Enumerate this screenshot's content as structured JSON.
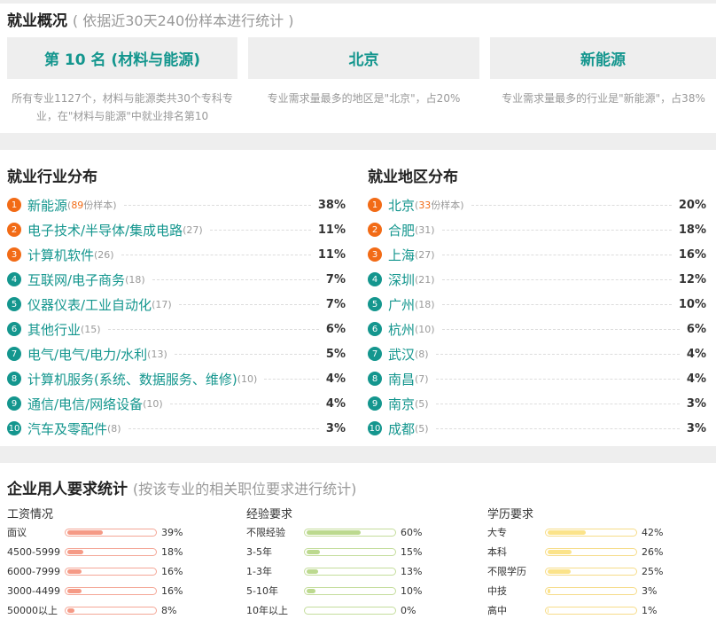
{
  "overview": {
    "title": "就业概况",
    "subtitle": "( 依据近30天240份样本进行统计 )",
    "cards": [
      {
        "main": "第 10 名 (材料与能源)",
        "desc": "所有专业1127个，材料与能源类共30个专科专业，在\"材料与能源\"中就业排名第10"
      },
      {
        "main": "北京",
        "desc": "专业需求量最多的地区是\"北京\"，占20%"
      },
      {
        "main": "新能源",
        "desc": "专业需求量最多的行业是\"新能源\"，占38%"
      }
    ]
  },
  "industry": {
    "title": "就业行业分布",
    "items": [
      {
        "rank": "1",
        "name": "新能源",
        "count_prefix": "(",
        "count_num": "89",
        "count_suffix": "份样本)",
        "pct": "38%"
      },
      {
        "rank": "2",
        "name": "电子技术/半导体/集成电路",
        "count_prefix": "(27)",
        "count_num": "",
        "count_suffix": "",
        "pct": "11%"
      },
      {
        "rank": "3",
        "name": "计算机软件",
        "count_prefix": "(26)",
        "count_num": "",
        "count_suffix": "",
        "pct": "11%"
      },
      {
        "rank": "4",
        "name": "互联网/电子商务",
        "count_prefix": "(18)",
        "count_num": "",
        "count_suffix": "",
        "pct": "7%"
      },
      {
        "rank": "5",
        "name": "仪器仪表/工业自动化",
        "count_prefix": "(17)",
        "count_num": "",
        "count_suffix": "",
        "pct": "7%"
      },
      {
        "rank": "6",
        "name": "其他行业",
        "count_prefix": "(15)",
        "count_num": "",
        "count_suffix": "",
        "pct": "6%"
      },
      {
        "rank": "7",
        "name": "电气/电气/电力/水利",
        "count_prefix": "(13)",
        "count_num": "",
        "count_suffix": "",
        "pct": "5%"
      },
      {
        "rank": "8",
        "name": "计算机服务(系统、数据服务、维修)",
        "count_prefix": "(10)",
        "count_num": "",
        "count_suffix": "",
        "pct": "4%"
      },
      {
        "rank": "9",
        "name": "通信/电信/网络设备",
        "count_prefix": "(10)",
        "count_num": "",
        "count_suffix": "",
        "pct": "4%"
      },
      {
        "rank": "10",
        "name": "汽车及零配件",
        "count_prefix": "(8)",
        "count_num": "",
        "count_suffix": "",
        "pct": "3%"
      }
    ]
  },
  "region": {
    "title": "就业地区分布",
    "items": [
      {
        "rank": "1",
        "name": "北京",
        "count_prefix": "(",
        "count_num": "33",
        "count_suffix": "份样本)",
        "pct": "20%"
      },
      {
        "rank": "2",
        "name": "合肥",
        "count_prefix": "(31)",
        "count_num": "",
        "count_suffix": "",
        "pct": "18%"
      },
      {
        "rank": "3",
        "name": "上海",
        "count_prefix": "(27)",
        "count_num": "",
        "count_suffix": "",
        "pct": "16%"
      },
      {
        "rank": "4",
        "name": "深圳",
        "count_prefix": "(21)",
        "count_num": "",
        "count_suffix": "",
        "pct": "12%"
      },
      {
        "rank": "5",
        "name": "广州",
        "count_prefix": "(18)",
        "count_num": "",
        "count_suffix": "",
        "pct": "10%"
      },
      {
        "rank": "6",
        "name": "杭州",
        "count_prefix": "(10)",
        "count_num": "",
        "count_suffix": "",
        "pct": "6%"
      },
      {
        "rank": "7",
        "name": "武汉",
        "count_prefix": "(8)",
        "count_num": "",
        "count_suffix": "",
        "pct": "4%"
      },
      {
        "rank": "8",
        "name": "南昌",
        "count_prefix": "(7)",
        "count_num": "",
        "count_suffix": "",
        "pct": "4%"
      },
      {
        "rank": "9",
        "name": "南京",
        "count_prefix": "(5)",
        "count_num": "",
        "count_suffix": "",
        "pct": "3%"
      },
      {
        "rank": "10",
        "name": "成都",
        "count_prefix": "(5)",
        "count_num": "",
        "count_suffix": "",
        "pct": "3%"
      }
    ]
  },
  "requirements": {
    "title": "企业用人要求统计",
    "subtitle": "(按该专业的相关职位要求进行统计)",
    "salary": {
      "title": "工资情况",
      "fill_color": "#f59a86",
      "border_color": "#f4a797",
      "rows": [
        {
          "label": "面议",
          "pct": "39%",
          "value": 0.39
        },
        {
          "label": "4500-5999",
          "pct": "18%",
          "value": 0.18
        },
        {
          "label": "6000-7999",
          "pct": "16%",
          "value": 0.16
        },
        {
          "label": "3000-4499",
          "pct": "16%",
          "value": 0.16
        },
        {
          "label": "50000以上",
          "pct": "8%",
          "value": 0.08
        }
      ]
    },
    "experience": {
      "title": "经验要求",
      "fill_color": "#bcd98f",
      "border_color": "#c4dd9c",
      "rows": [
        {
          "label": "不限经验",
          "pct": "60%",
          "value": 0.6
        },
        {
          "label": "3-5年",
          "pct": "15%",
          "value": 0.15
        },
        {
          "label": "1-3年",
          "pct": "13%",
          "value": 0.13
        },
        {
          "label": "5-10年",
          "pct": "10%",
          "value": 0.1
        },
        {
          "label": "10年以上",
          "pct": "0%",
          "value": 0.0
        }
      ]
    },
    "education": {
      "title": "学历要求",
      "fill_color": "#fbe38a",
      "border_color": "#f6dc8a",
      "rows": [
        {
          "label": "大专",
          "pct": "42%",
          "value": 0.42
        },
        {
          "label": "本科",
          "pct": "26%",
          "value": 0.26
        },
        {
          "label": "不限学历",
          "pct": "25%",
          "value": 0.25
        },
        {
          "label": "中技",
          "pct": "3%",
          "value": 0.03
        },
        {
          "label": "高中",
          "pct": "1%",
          "value": 0.01
        }
      ]
    }
  }
}
